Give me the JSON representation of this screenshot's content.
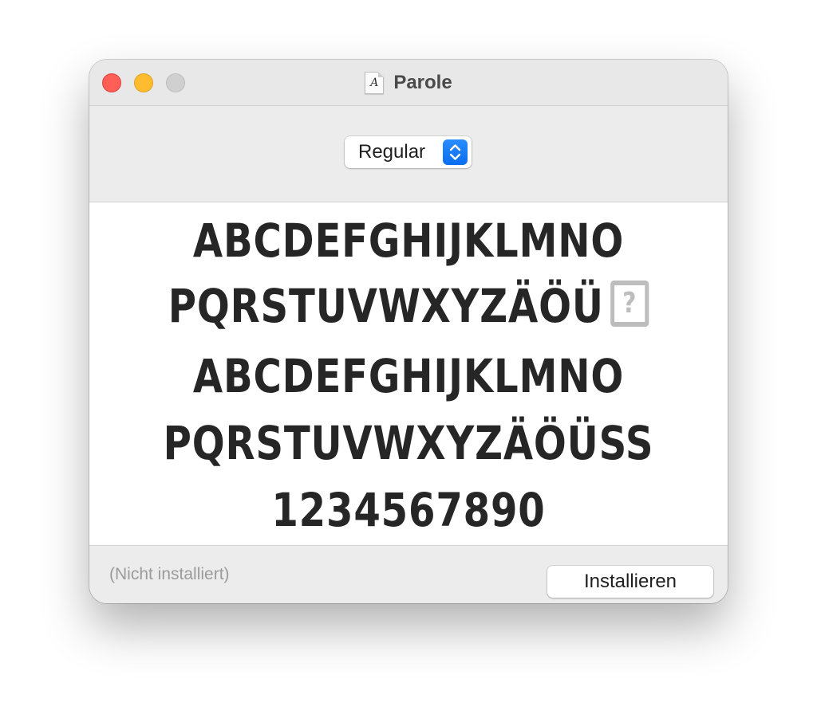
{
  "window": {
    "title": "Parole",
    "doc_icon_glyph": "A"
  },
  "colors": {
    "close": "#ff5f57",
    "minimize": "#febc2e",
    "zoom": "#d0d0d0",
    "accent": "#0a6ef0"
  },
  "toolbar": {
    "style_select": {
      "selected": "Regular"
    }
  },
  "preview": {
    "lines": [
      "ABCDEFGHIJKLMNO",
      "PQRSTUVWXYZÄÖÜ",
      "ABCDEFGHIJKLMNO",
      "PQRSTUVWXYZÄÖÜSS",
      "1234567890"
    ],
    "missing_glyph": "?"
  },
  "footer": {
    "status": "(Nicht installiert)",
    "install_button": "Installieren"
  }
}
